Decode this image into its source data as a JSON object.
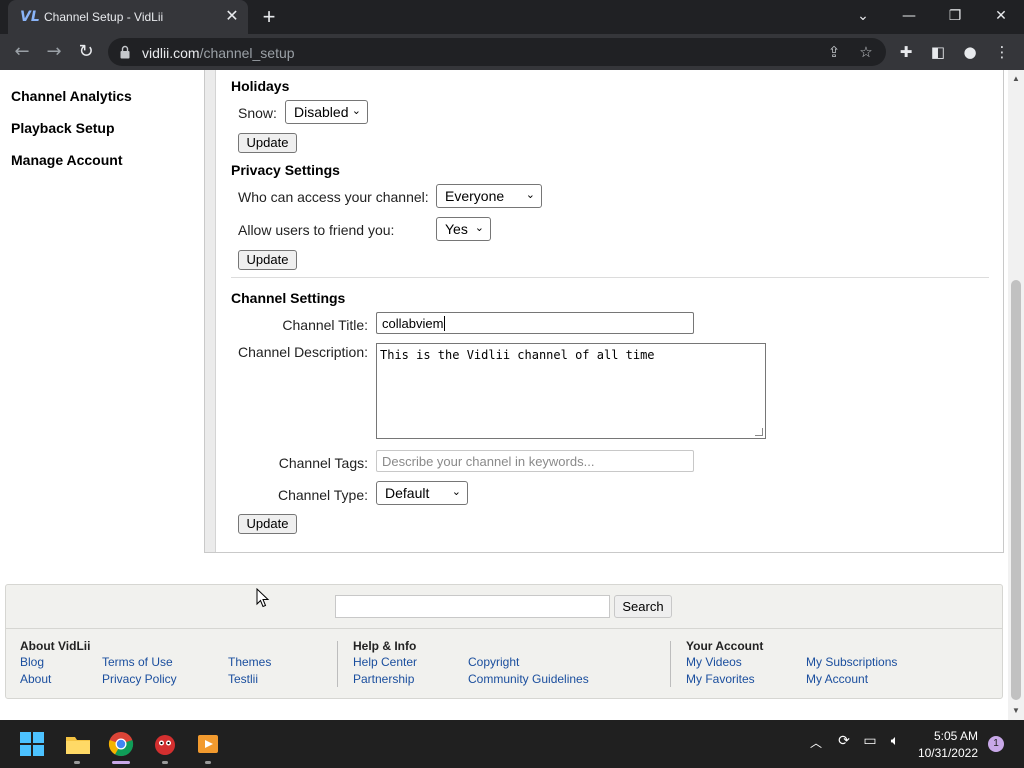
{
  "browser": {
    "tab_title": "Channel Setup - VidLii",
    "favicon_text": "VL",
    "url_host": "vidlii.com",
    "url_path": "/channel_setup"
  },
  "sidebar": {
    "items": [
      {
        "label": "Channel Analytics"
      },
      {
        "label": "Playback Setup"
      },
      {
        "label": "Manage Account"
      }
    ]
  },
  "holidays": {
    "title": "Holidays",
    "snow_label": "Snow:",
    "snow_value": "Disabled",
    "update_label": "Update"
  },
  "privacy": {
    "title": "Privacy Settings",
    "access_label": "Who can access your channel:",
    "access_value": "Everyone",
    "friend_label": "Allow users to friend you:",
    "friend_value": "Yes",
    "update_label": "Update"
  },
  "channel": {
    "title": "Channel Settings",
    "title_label": "Channel Title:",
    "title_value": "collabviem",
    "desc_label": "Channel Description:",
    "desc_value": "This is the Vidlii channel of all time",
    "tags_label": "Channel Tags:",
    "tags_placeholder": "Describe your channel in keywords...",
    "type_label": "Channel Type:",
    "type_value": "Default",
    "update_label": "Update"
  },
  "footer": {
    "search_label": "Search",
    "columns": [
      {
        "heading": "About VidLii",
        "links": [
          "Blog",
          "Terms of Use",
          "Themes",
          "About",
          "Privacy Policy",
          "Testlii"
        ]
      },
      {
        "heading": "Help & Info",
        "links": [
          "Help Center",
          "Copyright",
          "Partnership",
          "Community Guidelines"
        ]
      },
      {
        "heading": "Your Account",
        "links": [
          "My Videos",
          "My Subscriptions",
          "My Favorites",
          "My Account"
        ]
      }
    ]
  },
  "taskbar": {
    "time": "5:05 AM",
    "date": "10/31/2022",
    "notification_count": "1"
  }
}
